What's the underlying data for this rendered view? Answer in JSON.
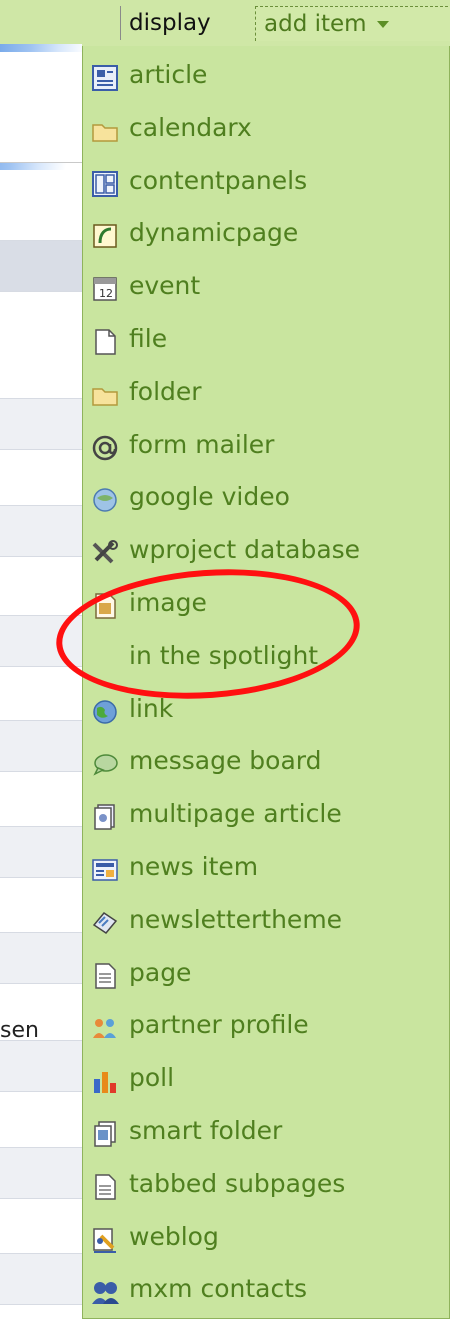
{
  "header": {
    "display_tab": "display",
    "add_item_tab": "add item"
  },
  "left_panel": {
    "partial_text": "sen"
  },
  "menu": {
    "items": [
      {
        "label": "article",
        "icon": "article-icon"
      },
      {
        "label": "calendarx",
        "icon": "folder-icon"
      },
      {
        "label": "contentpanels",
        "icon": "contentpanels-icon"
      },
      {
        "label": "dynamicpage",
        "icon": "dynamicpage-icon"
      },
      {
        "label": "event",
        "icon": "event-icon"
      },
      {
        "label": "file",
        "icon": "file-icon"
      },
      {
        "label": "folder",
        "icon": "folder-icon"
      },
      {
        "label": "form mailer",
        "icon": "at-icon"
      },
      {
        "label": "google video",
        "icon": "google-video-icon"
      },
      {
        "label": "wproject database",
        "icon": "tools-icon"
      },
      {
        "label": "image",
        "icon": "image-icon"
      },
      {
        "label": "in the spotlight",
        "icon": ""
      },
      {
        "label": "link",
        "icon": "globe-icon"
      },
      {
        "label": "message board",
        "icon": "message-board-icon"
      },
      {
        "label": "multipage article",
        "icon": "multipage-article-icon"
      },
      {
        "label": "news item",
        "icon": "news-icon"
      },
      {
        "label": "newslettertheme",
        "icon": "newsletter-icon"
      },
      {
        "label": "page",
        "icon": "page-icon"
      },
      {
        "label": "partner profile",
        "icon": "people-icon"
      },
      {
        "label": "poll",
        "icon": "bar-chart-icon"
      },
      {
        "label": "smart folder",
        "icon": "smart-folder-icon"
      },
      {
        "label": "tabbed subpages",
        "icon": "tabbed-page-icon"
      },
      {
        "label": "weblog",
        "icon": "weblog-icon"
      },
      {
        "label": "mxm contacts",
        "icon": "contacts-icon"
      }
    ]
  },
  "colors": {
    "menu_bg": "#c9e59f",
    "menu_text": "#4f7f1f",
    "annotation": "#ff1010"
  }
}
